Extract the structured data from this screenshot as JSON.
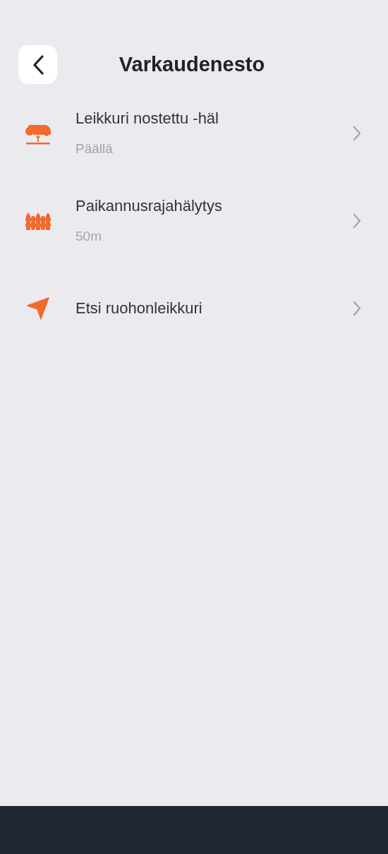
{
  "header": {
    "title": "Varkaudenesto"
  },
  "items": [
    {
      "kind": "lift",
      "title": "Leikkuri nostettu -häl",
      "value": "Päällä"
    },
    {
      "kind": "fence",
      "title": "Paikannusrajahälytys",
      "value": "50m"
    },
    {
      "kind": "locate",
      "title": "Etsi ruohonleikkuri"
    }
  ]
}
